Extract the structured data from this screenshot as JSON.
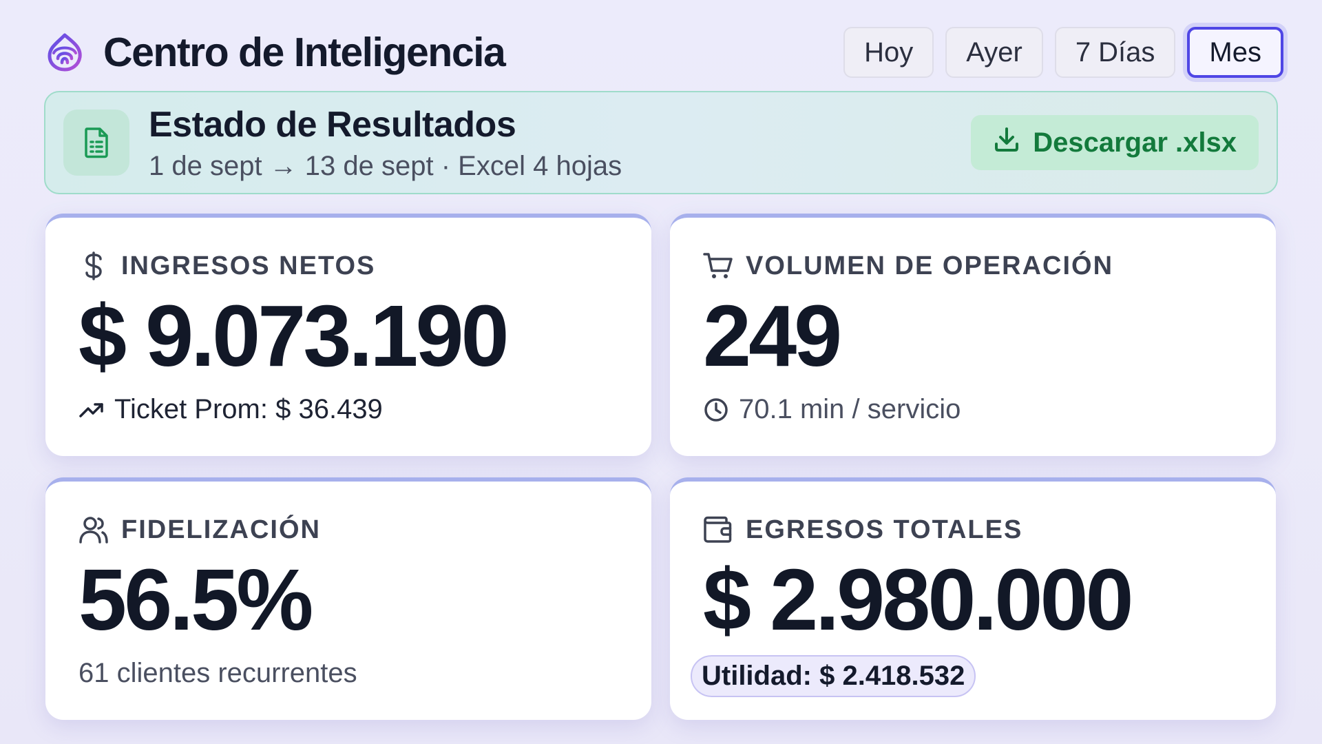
{
  "app": {
    "title": "Centro de Inteligencia",
    "logo_icon": "fingerprint-logo-icon",
    "accent": "#4f46e5"
  },
  "range_tabs": [
    {
      "label": "Hoy",
      "active": false
    },
    {
      "label": "Ayer",
      "active": false
    },
    {
      "label": "7 Días",
      "active": false
    },
    {
      "label": "Mes",
      "active": true
    }
  ],
  "report": {
    "icon": "spreadsheet-file-icon",
    "title": "Estado de Resultados",
    "subtitle": "1 de sept → 13 de sept · Excel 4 hojas",
    "download_icon": "download-icon",
    "download_label": "Descargar .xlsx",
    "download_color": "#137a3c"
  },
  "cards": [
    {
      "icon": "dollar-icon",
      "label": "INGRESOS NETOS",
      "value": "$ 9.073.190",
      "foot_icon": "trending-up-icon",
      "foot": "Ticket Prom: $ 36.439"
    },
    {
      "icon": "shopping-cart-icon",
      "label": "VOLUMEN DE OPERACIÓN",
      "value": "249",
      "foot_icon": "clock-icon",
      "foot": "70.1 min / servicio"
    },
    {
      "icon": "users-icon",
      "label": "FIDELIZACIÓN",
      "value": "56.5%",
      "foot": "61 clientes recurrentes"
    },
    {
      "icon": "wallet-icon",
      "label": "EGRESOS TOTALES",
      "value": "$ 2.980.000",
      "foot": "Utilidad: $ 2.418.532"
    }
  ]
}
